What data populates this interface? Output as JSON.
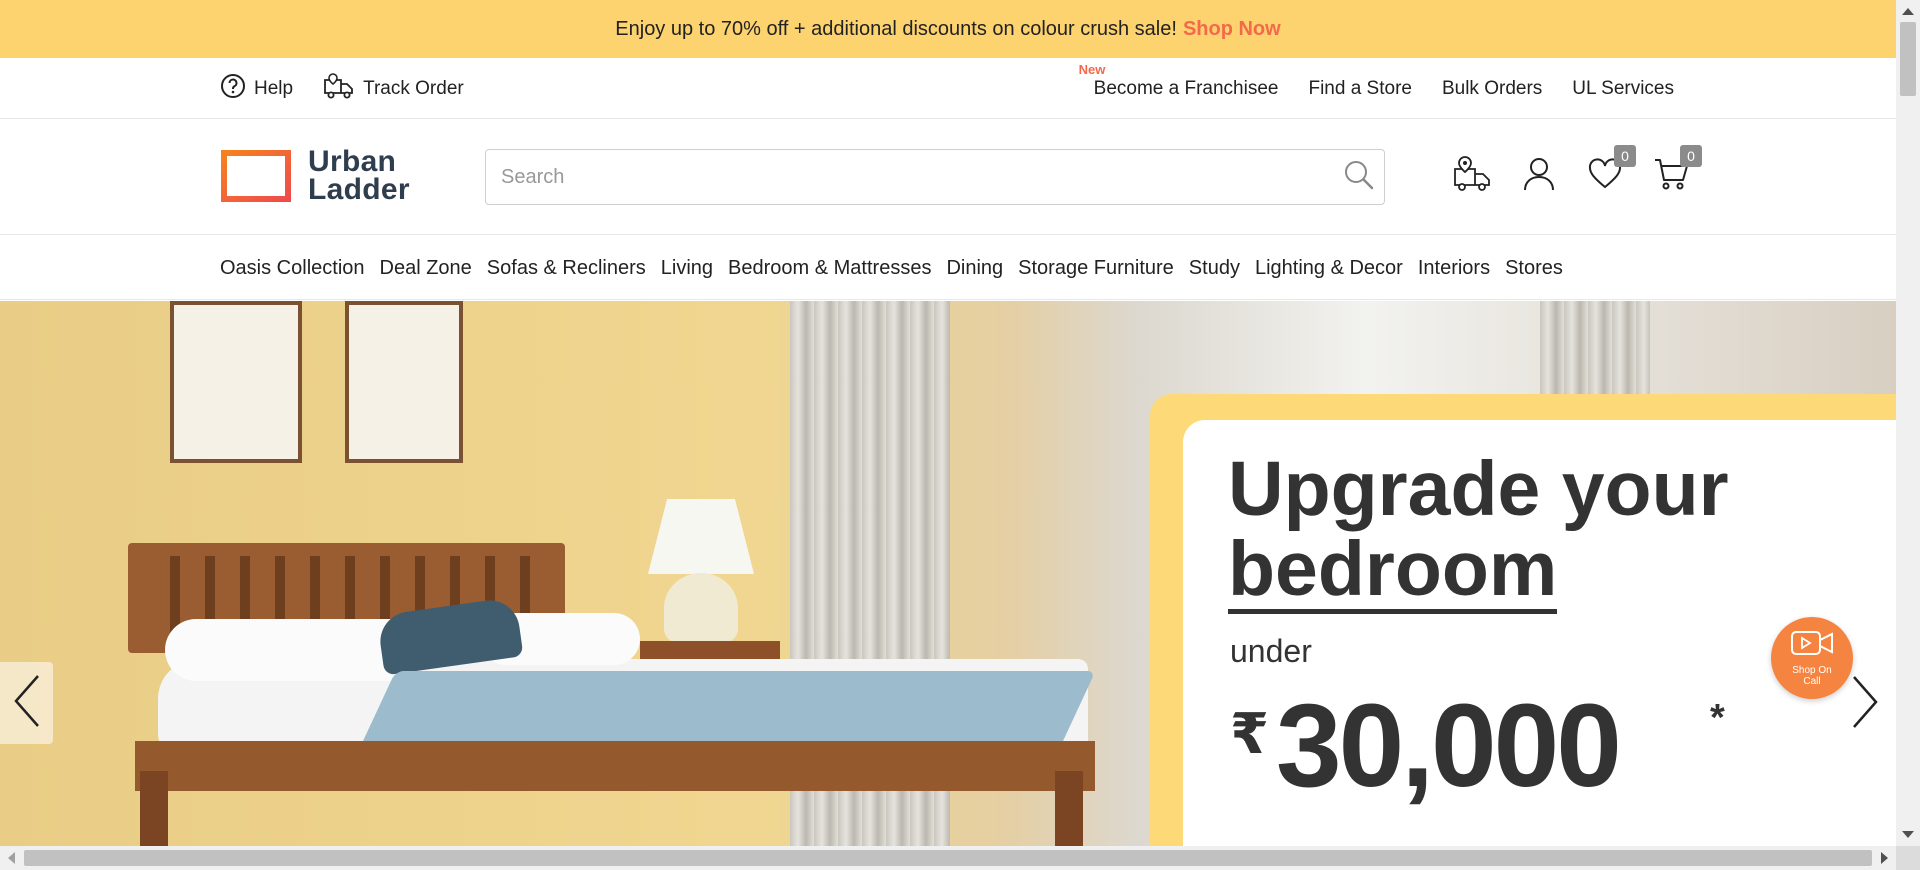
{
  "announcement": {
    "text": "Enjoy up to 70% off + additional discounts on colour crush sale!",
    "link": "Shop Now"
  },
  "utility": {
    "help": "Help",
    "track_order": "Track Order",
    "new_tag": "New",
    "links": [
      "Become a Franchisee",
      "Find a Store",
      "Bulk Orders",
      "UL Services"
    ]
  },
  "brand": {
    "line1": "Urban",
    "line2": "Ladder",
    "accent": "#f26a4b"
  },
  "search": {
    "placeholder": "Search"
  },
  "header_icons": {
    "wishlist_count": "0",
    "cart_count": "0"
  },
  "nav": {
    "items": [
      "Oasis Collection",
      "Deal Zone",
      "Sofas & Recliners",
      "Living",
      "Bedroom & Mattresses",
      "Dining",
      "Storage Furniture",
      "Study",
      "Lighting & Decor",
      "Interiors",
      "Stores"
    ]
  },
  "hero": {
    "headline1": "Upgrade your",
    "headline2": "bedroom",
    "under": "under",
    "currency": "₹",
    "amount": "30,000",
    "asterisk": "*"
  },
  "shop_on_call": {
    "line1": "Shop On",
    "line2": "Call"
  }
}
